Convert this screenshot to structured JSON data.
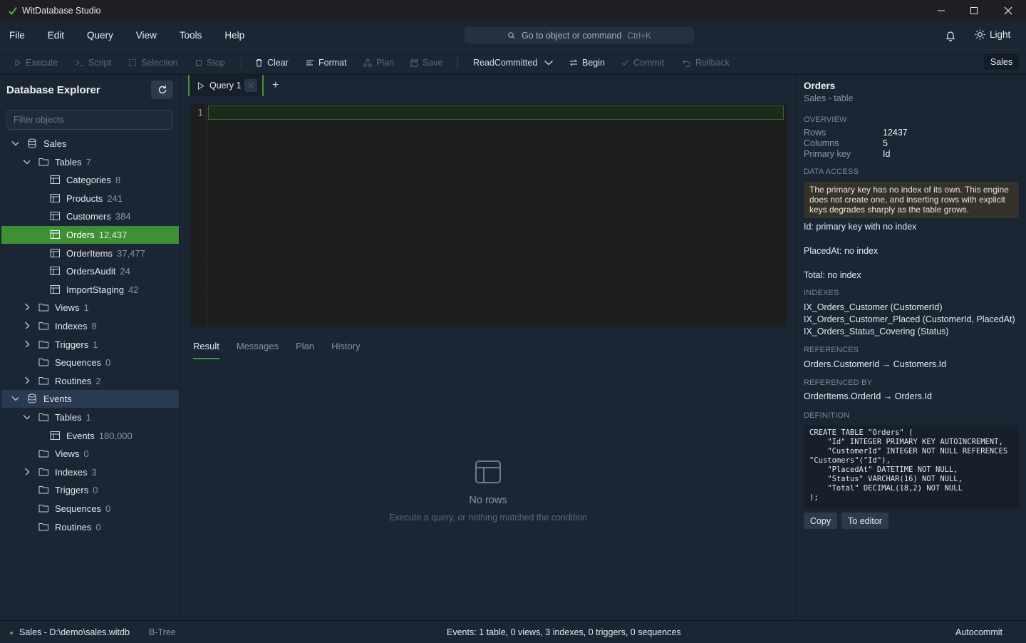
{
  "window": {
    "title": "WitDatabase Studio",
    "app_icon": "check-leaf-icon",
    "accent": "#3e9a35"
  },
  "menu": {
    "items": [
      "File",
      "Edit",
      "Query",
      "View",
      "Tools",
      "Help"
    ]
  },
  "command_palette": {
    "label": "Go to object or command",
    "shortcut": "Ctrl+K"
  },
  "theme_toggle": {
    "label": "Light"
  },
  "toolbar": {
    "execute": "Execute",
    "script": "Script",
    "selection": "Selection",
    "stop": "Stop",
    "clear": "Clear",
    "format": "Format",
    "plan": "Plan",
    "save": "Save",
    "isolation": "ReadCommitted",
    "begin": "Begin",
    "commit": "Commit",
    "rollback": "Rollback",
    "database_badge": "Sales"
  },
  "sidebar": {
    "title": "Database Explorer",
    "filter_placeholder": "Filter objects",
    "tree": [
      {
        "label": "Sales",
        "count": "",
        "type": "db",
        "expanded": true
      },
      {
        "label": "Tables",
        "count": "7",
        "type": "folder",
        "expanded": true
      },
      {
        "label": "Categories",
        "count": "8",
        "type": "table"
      },
      {
        "label": "Products",
        "count": "241",
        "type": "table"
      },
      {
        "label": "Customers",
        "count": "384",
        "type": "table"
      },
      {
        "label": "Orders",
        "count": "12,437",
        "type": "table",
        "selected": true
      },
      {
        "label": "OrderItems",
        "count": "37,477",
        "type": "table"
      },
      {
        "label": "OrdersAudit",
        "count": "24",
        "type": "table"
      },
      {
        "label": "ImportStaging",
        "count": "42",
        "type": "table"
      },
      {
        "label": "Views",
        "count": "1",
        "type": "folder",
        "expanded": false
      },
      {
        "label": "Indexes",
        "count": "8",
        "type": "folder",
        "expanded": false
      },
      {
        "label": "Triggers",
        "count": "1",
        "type": "folder",
        "expanded": false
      },
      {
        "label": "Sequences",
        "count": "0",
        "type": "folder"
      },
      {
        "label": "Routines",
        "count": "2",
        "type": "folder",
        "expanded": false
      },
      {
        "label": "Events",
        "count": "",
        "type": "db",
        "expanded": true
      },
      {
        "label": "Tables",
        "count": "1",
        "type": "folder",
        "expanded": true
      },
      {
        "label": "Events",
        "count": "180,000",
        "type": "table"
      },
      {
        "label": "Views",
        "count": "0",
        "type": "folder"
      },
      {
        "label": "Indexes",
        "count": "3",
        "type": "folder",
        "expanded": false
      },
      {
        "label": "Triggers",
        "count": "0",
        "type": "folder"
      },
      {
        "label": "Sequences",
        "count": "0",
        "type": "folder"
      },
      {
        "label": "Routines",
        "count": "0",
        "type": "folder"
      }
    ]
  },
  "editor": {
    "tab_label": "Query 1",
    "add_tab": "+",
    "line_number": "1",
    "result_tabs": [
      "Result",
      "Messages",
      "Plan",
      "History"
    ],
    "empty_title": "No rows",
    "empty_subtitle": "Execute a query, or nothing matched the condition"
  },
  "details": {
    "title": "Orders",
    "subtitle": "Sales - table",
    "overview_heading": "OVERVIEW",
    "rows_label": "Rows",
    "rows_value": "12437",
    "columns_label": "Columns",
    "columns_value": "5",
    "pk_label": "Primary key",
    "pk_value": "Id",
    "data_access_heading": "DATA ACCESS",
    "warning": "The primary key has no index of its own. This engine does not create one, and inserting rows with explicit keys degrades sharply as the table grows.",
    "access_lines": [
      "Id: primary key with no index",
      "PlacedAt: no index",
      "Total: no index"
    ],
    "indexes_heading": "INDEXES",
    "indexes": [
      "IX_Orders_Customer (CustomerId)",
      "IX_Orders_Customer_Placed (CustomerId, PlacedAt)",
      "IX_Orders_Status_Covering (Status)"
    ],
    "references_heading": "REFERENCES",
    "references": [
      "Orders.CustomerId → Customers.Id"
    ],
    "referenced_by_heading": "REFERENCED BY",
    "referenced_by": [
      "OrderItems.OrderId → Orders.Id"
    ],
    "definition_heading": "DEFINITION",
    "definition": "CREATE TABLE \"Orders\" (\n    \"Id\" INTEGER PRIMARY KEY AUTOINCREMENT,\n    \"CustomerId\" INTEGER NOT NULL REFERENCES\n\"Customers\"(\"Id\"),\n    \"PlacedAt\" DATETIME NOT NULL,\n    \"Status\" VARCHAR(16) NOT NULL,\n    \"Total\" DECIMAL(18,2) NOT NULL\n);",
    "copy_label": "Copy",
    "to_editor_label": "To editor"
  },
  "statusbar": {
    "connection": "Sales - D:\\demo\\sales.witdb",
    "engine": "B-Tree",
    "summary": "Events: 1 table, 0 views, 3 indexes, 0 triggers, 0 sequences",
    "mode": "Autocommit"
  }
}
